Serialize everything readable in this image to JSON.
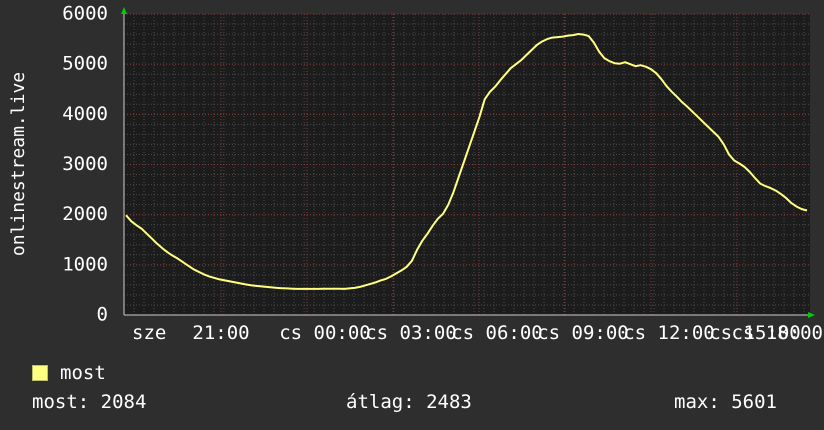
{
  "chart_data": {
    "type": "line",
    "ylabel": "onlinestream.live",
    "ylim": [
      0,
      6000
    ],
    "yticks": [
      0,
      1000,
      2000,
      3000,
      4000,
      5000,
      6000
    ],
    "x_tick_labels": [
      "sze",
      "21:00",
      "cs 00:00",
      "cs 03:00",
      "cs 06:00",
      "cs 09:00",
      "cs 12:00",
      "cs 15:00",
      "cs 18:00"
    ],
    "grid": true,
    "series": [
      {
        "name": "most",
        "color": "#ffff80",
        "points": [
          [
            0,
            1990
          ],
          [
            4,
            1870
          ],
          [
            8,
            1790
          ],
          [
            12,
            1720
          ],
          [
            16,
            1620
          ],
          [
            20,
            1520
          ],
          [
            24,
            1420
          ],
          [
            28,
            1330
          ],
          [
            32,
            1250
          ],
          [
            36,
            1180
          ],
          [
            40,
            1120
          ],
          [
            44,
            1050
          ],
          [
            48,
            980
          ],
          [
            52,
            910
          ],
          [
            56,
            860
          ],
          [
            60,
            810
          ],
          [
            64,
            770
          ],
          [
            68,
            740
          ],
          [
            72,
            710
          ],
          [
            76,
            690
          ],
          [
            80,
            670
          ],
          [
            84,
            650
          ],
          [
            88,
            630
          ],
          [
            92,
            610
          ],
          [
            96,
            595
          ],
          [
            100,
            580
          ],
          [
            104,
            570
          ],
          [
            108,
            560
          ],
          [
            112,
            550
          ],
          [
            116,
            540
          ],
          [
            120,
            535
          ],
          [
            124,
            530
          ],
          [
            128,
            525
          ],
          [
            132,
            520
          ],
          [
            136,
            520
          ],
          [
            140,
            520
          ],
          [
            144,
            520
          ],
          [
            148,
            520
          ],
          [
            152,
            525
          ],
          [
            156,
            525
          ],
          [
            160,
            525
          ],
          [
            164,
            522
          ],
          [
            168,
            520
          ],
          [
            172,
            530
          ],
          [
            176,
            540
          ],
          [
            180,
            560
          ],
          [
            184,
            590
          ],
          [
            188,
            620
          ],
          [
            192,
            650
          ],
          [
            196,
            690
          ],
          [
            200,
            720
          ],
          [
            204,
            770
          ],
          [
            208,
            830
          ],
          [
            212,
            890
          ],
          [
            216,
            960
          ],
          [
            220,
            1080
          ],
          [
            224,
            1300
          ],
          [
            228,
            1480
          ],
          [
            232,
            1620
          ],
          [
            236,
            1780
          ],
          [
            240,
            1920
          ],
          [
            244,
            2020
          ],
          [
            248,
            2200
          ],
          [
            252,
            2450
          ],
          [
            256,
            2750
          ],
          [
            260,
            3050
          ],
          [
            264,
            3350
          ],
          [
            268,
            3650
          ],
          [
            272,
            3950
          ],
          [
            276,
            4300
          ],
          [
            280,
            4450
          ],
          [
            284,
            4550
          ],
          [
            288,
            4680
          ],
          [
            292,
            4800
          ],
          [
            296,
            4920
          ],
          [
            300,
            5000
          ],
          [
            304,
            5080
          ],
          [
            308,
            5180
          ],
          [
            312,
            5280
          ],
          [
            316,
            5380
          ],
          [
            320,
            5450
          ],
          [
            324,
            5500
          ],
          [
            328,
            5530
          ],
          [
            332,
            5540
          ],
          [
            336,
            5550
          ],
          [
            340,
            5570
          ],
          [
            344,
            5580
          ],
          [
            348,
            5601
          ],
          [
            352,
            5590
          ],
          [
            356,
            5560
          ],
          [
            360,
            5430
          ],
          [
            364,
            5250
          ],
          [
            368,
            5120
          ],
          [
            372,
            5060
          ],
          [
            376,
            5020
          ],
          [
            380,
            5010
          ],
          [
            384,
            5040
          ],
          [
            388,
            5000
          ],
          [
            392,
            4960
          ],
          [
            396,
            4980
          ],
          [
            400,
            4950
          ],
          [
            404,
            4900
          ],
          [
            408,
            4820
          ],
          [
            412,
            4700
          ],
          [
            416,
            4560
          ],
          [
            420,
            4450
          ],
          [
            424,
            4350
          ],
          [
            428,
            4240
          ],
          [
            432,
            4150
          ],
          [
            436,
            4050
          ],
          [
            440,
            3950
          ],
          [
            444,
            3850
          ],
          [
            448,
            3750
          ],
          [
            452,
            3650
          ],
          [
            456,
            3550
          ],
          [
            460,
            3400
          ],
          [
            464,
            3200
          ],
          [
            468,
            3080
          ],
          [
            472,
            3020
          ],
          [
            476,
            2950
          ],
          [
            480,
            2850
          ],
          [
            484,
            2730
          ],
          [
            488,
            2620
          ],
          [
            492,
            2570
          ],
          [
            496,
            2530
          ],
          [
            500,
            2480
          ],
          [
            504,
            2410
          ],
          [
            508,
            2330
          ],
          [
            512,
            2230
          ],
          [
            516,
            2160
          ],
          [
            520,
            2110
          ],
          [
            524,
            2084
          ]
        ]
      }
    ]
  },
  "legend": {
    "label": "most",
    "color": "#ffff80"
  },
  "stats": {
    "current": "most: 2084",
    "average": "átlag: 2483",
    "maximum": "max: 5601"
  }
}
